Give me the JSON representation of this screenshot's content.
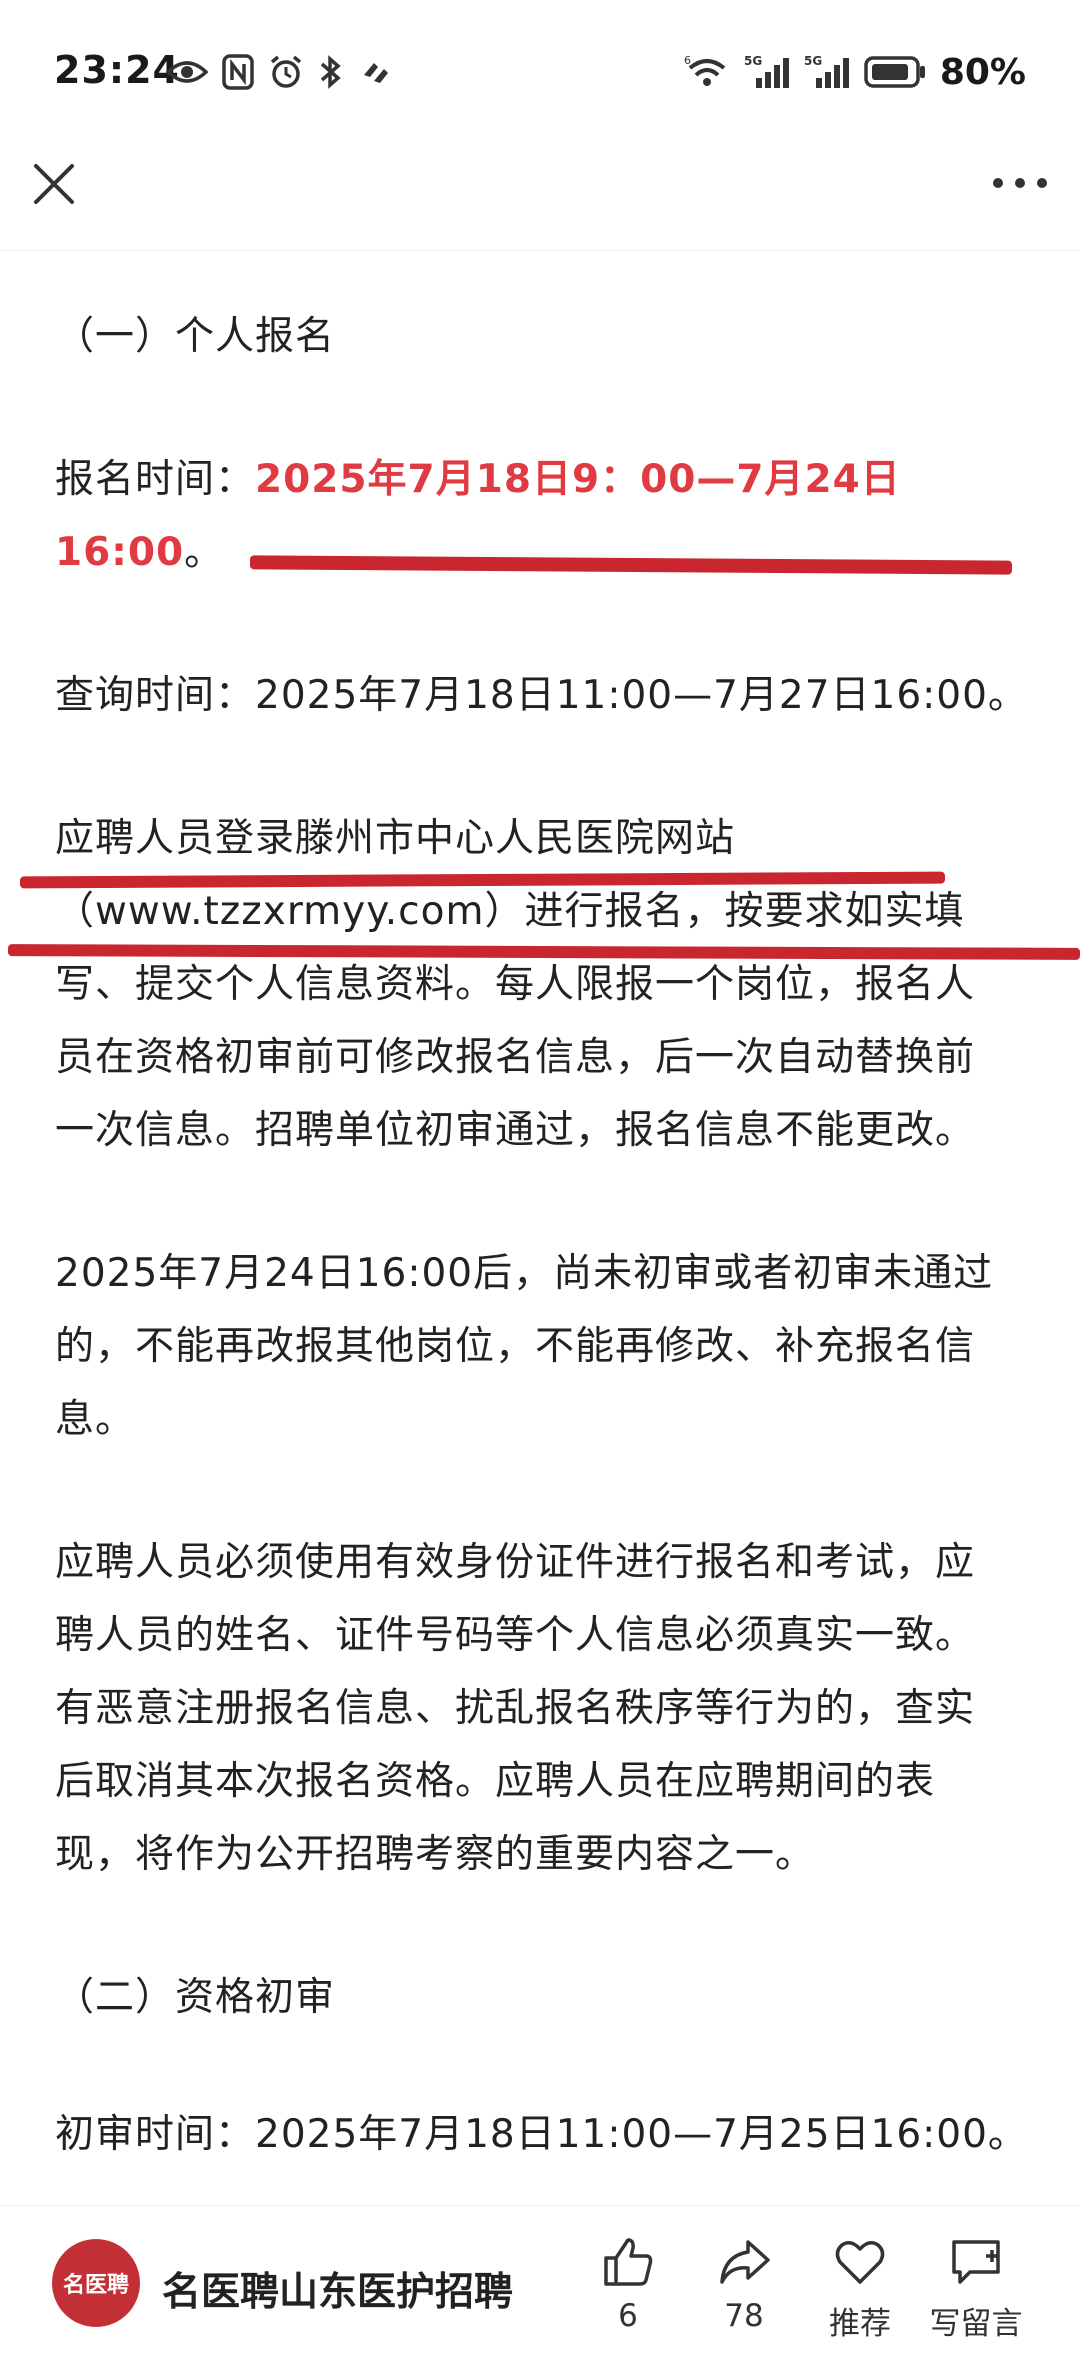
{
  "status_bar": {
    "time": "23:24",
    "battery": "80%",
    "signal_1": "5G",
    "signal_2": "5G",
    "wifi_badge": "6"
  },
  "article": {
    "section1_heading": "（一）个人报名",
    "reg_time_label": "报名时间：",
    "reg_time_value_line1": "2025年7月18日9：00—7月24日",
    "reg_time_value_line2": "16:00",
    "reg_time_end": "。",
    "query_time": "查询时间：2025年7月18日11:00—7月27日16:00。",
    "p_register_lines": [
      "应聘人员登录滕州市中心人民医院网站",
      "（www.tzzxrmyy.com）进行报名，按要求如实填",
      "写、提交个人信息资料。每人限报一个岗位，报名人",
      "员在资格初审前可修改报名信息，后一次自动替换前",
      "一次信息。招聘单位初审通过，报名信息不能更改。"
    ],
    "p_deadline_lines": [
      "2025年7月24日16:00后，尚未初审或者初审未通过",
      "的，不能再改报其他岗位，不能再修改、补充报名信",
      "息。"
    ],
    "p_id_lines": [
      "应聘人员必须使用有效身份证件进行报名和考试，应",
      "聘人员的姓名、证件号码等个人信息必须真实一致。",
      "有恶意注册报名信息、扰乱报名秩序等行为的，查实",
      "后取消其本次报名资格。应聘人员在应聘期间的表",
      "现，将作为公开招聘考察的重要内容之一。"
    ],
    "section2_heading": "（二）资格初审",
    "review_time": "初审时间：2025年7月18日11:00—7月25日16:00。"
  },
  "bottom_bar": {
    "logo_text": "名医聘",
    "account_name": "名医聘山东医护招聘",
    "like_count": "6",
    "share_count": "78",
    "recommend_label": "推荐",
    "comment_label": "写留言"
  },
  "colors": {
    "highlight": "#e03b42",
    "ink_underline": "#c9262f",
    "logo_bg": "#c22f35"
  },
  "icons": [
    "eye-icon",
    "nfc-icon",
    "alarm-icon",
    "bluetooth-icon",
    "hotspot-icon",
    "wifi-icon",
    "signal-icon",
    "battery-icon",
    "close-icon",
    "more-icon",
    "thumbs-up-icon",
    "share-icon",
    "heart-icon",
    "comment-icon"
  ]
}
